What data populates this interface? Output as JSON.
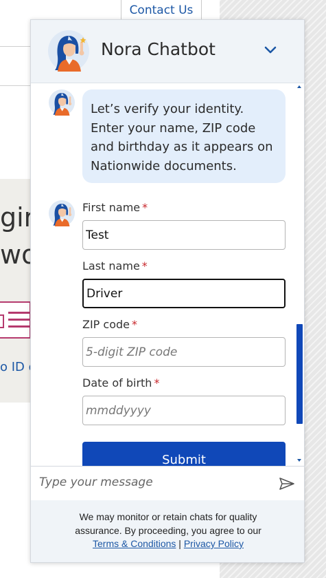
{
  "background_page": {
    "contact_link": "Contact Us",
    "heading_line1": "gir",
    "heading_line2": "wo",
    "link_fragment": "o ID o"
  },
  "chat": {
    "title": "Nora Chatbot",
    "message": "Let’s verify your identity. Enter your name, ZIP code and birthday as it appears on Nationwide documents.",
    "form": {
      "first_name": {
        "label": "First name",
        "required_mark": "*",
        "value": "Test",
        "placeholder": ""
      },
      "last_name": {
        "label": "Last name",
        "required_mark": "*",
        "value": "Driver",
        "placeholder": ""
      },
      "zip_code": {
        "label": "ZIP code",
        "required_mark": "*",
        "value": "",
        "placeholder": "5-digit ZIP code"
      },
      "dob": {
        "label": "Date of birth",
        "required_mark": "*",
        "value": "",
        "placeholder": "mmddyyyy"
      },
      "submit_label": "Submit"
    },
    "composer": {
      "placeholder": "Type your message"
    },
    "footer": {
      "notice": "We may monitor or retain chats for quality assurance. By proceeding, you agree to our",
      "terms_label": "Terms & Conditions",
      "separator": "|",
      "privacy_label": "Privacy Policy"
    }
  },
  "icons": {
    "avatar": "nora-avatar-icon",
    "collapse": "chevron-down-icon",
    "send": "send-icon",
    "scroll_up": "scroll-up-arrow-icon",
    "scroll_down": "scroll-down-arrow-icon"
  },
  "colors": {
    "brand_blue": "#1048b8",
    "link_blue": "#1c57a5",
    "bubble_bg": "#e3eefb",
    "header_bg": "#f0f4f8",
    "required_red": "#c8272c"
  }
}
